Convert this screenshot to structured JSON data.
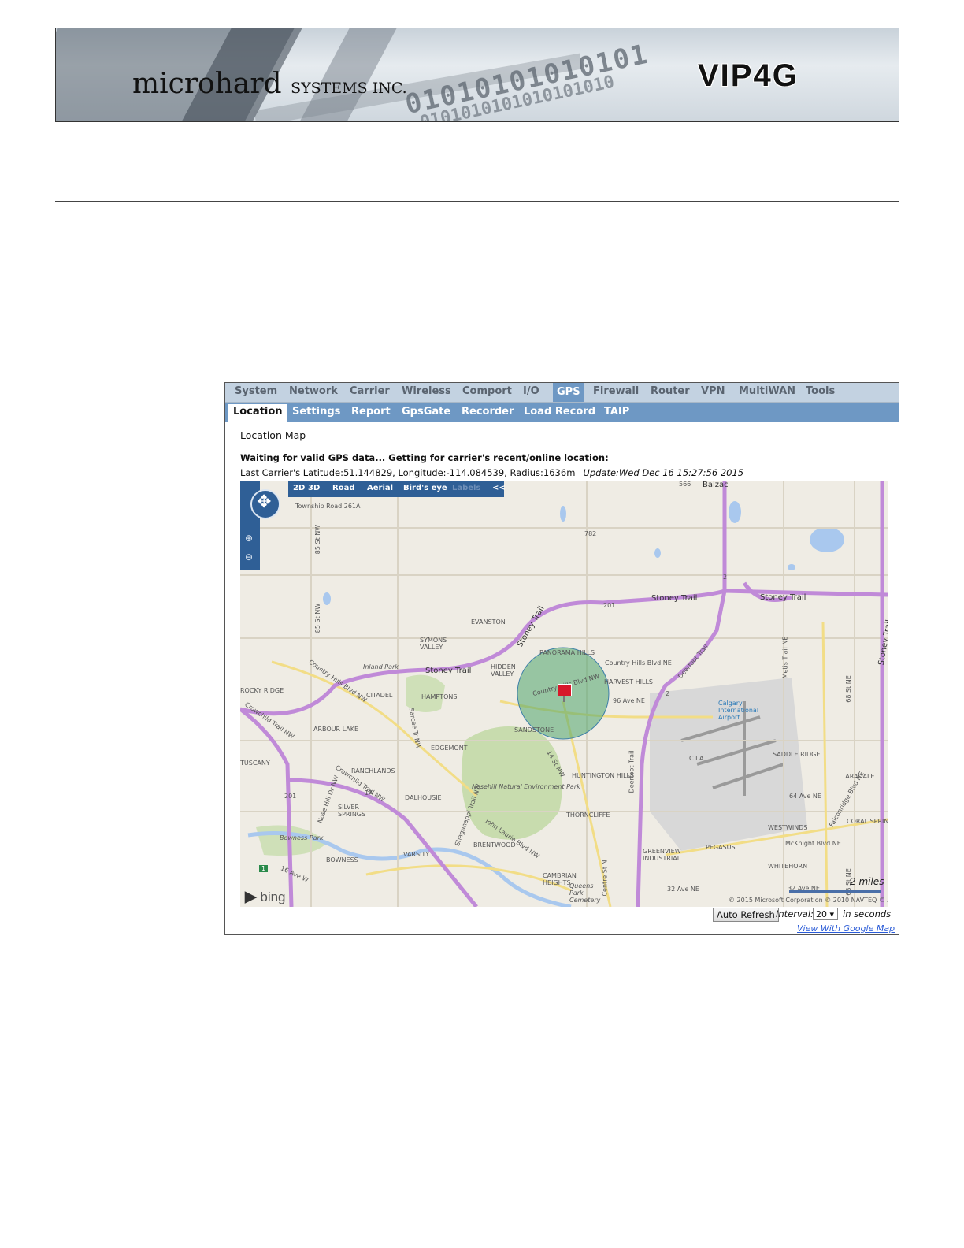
{
  "header": {
    "brand_main": "microhard",
    "brand_suffix": "SYSTEMS INC.",
    "product": "VIP4G",
    "binary_top": "01010101010101",
    "binary_bottom": "0101010101010101010"
  },
  "menu": {
    "items": [
      "System",
      "Network",
      "Carrier",
      "Wireless",
      "Comport",
      "I/O",
      "GPS",
      "Firewall",
      "Router",
      "VPN",
      "MultiWAN",
      "Tools"
    ],
    "active": "GPS"
  },
  "submenu": {
    "items": [
      "Location",
      "Settings",
      "Report",
      "GpsGate",
      "Recorder",
      "Load Record",
      "TAIP"
    ],
    "active": "Location"
  },
  "content": {
    "title": "Location Map",
    "waiting": "Waiting for valid GPS data... Getting for carrier's recent/online location:",
    "coords": "Last Carrier's Latitude:51.144829, Longitude:-114.084539, Radius:1636m",
    "update": "Update:Wed Dec 16 15:27:56 2015"
  },
  "map": {
    "nav": {
      "d2": "2D",
      "d3": "3D",
      "road": "Road",
      "aerial": "Aerial",
      "birds_eye": "Bird's eye",
      "labels": "Labels",
      "collapse": "<<"
    },
    "provider": "bing",
    "scale_label": "2 miles",
    "copyright": "© 2015 Microsoft Corporation   © 2010 NAVTEQ   © AND",
    "labels": {
      "balzac": "Balzac",
      "township": "Township Road 261A",
      "stoney1": "Stoney Trail",
      "stoney2": "Stoney Trail",
      "stoney3": "Stoney Trail",
      "stoney4": "Stoney Trail",
      "stoney_right": "Stoney Trail",
      "country_hills": "Country Hills Blvd NE",
      "country_hills2": "Country Hills Blvd NW",
      "country_hills_center": "Country Hills Blvd NW",
      "deerfoot": "Deerfoot Trail",
      "deerfoot2": "Deerfoot Trail",
      "ave96": "96 Ave NE",
      "ave64": "64 Ave NE",
      "ave32": "32 Ave NE",
      "ave32b": "32 Ave NE",
      "mcknight": "McKnight Blvd NE",
      "crowchild": "Crowchild Trail NW",
      "ave16": "16 Ave W",
      "sarcee": "Sarcee Tr NW",
      "st85a": "85 St NW",
      "st85b": "85 St NW",
      "st14": "14 St NW",
      "shaganappi": "Shaganappi Trail NW",
      "john_laurie": "John Laurie Blvd NW",
      "centre": "Centre St N",
      "metis": "Metis Trail NE",
      "st68": "68 St NE",
      "st68b": "68 St NE",
      "nose_hill": "Nosehill Natural Environment Park",
      "airport": "Calgary International Airport",
      "queens": "Queens Park Cemetery",
      "inland": "Inland Park",
      "bowness_park": "Bowness Park",
      "evanston": "EVANSTON",
      "symons": "SYMONS VALLEY",
      "panorama": "PANORAMA HILLS",
      "hidden": "HIDDEN VALLEY",
      "harvest": "HARVEST HILLS",
      "kincora": "KINCORA",
      "hamptons": "HAMPTONS",
      "citadel": "CITADEL",
      "rocky": "ROCKY RIDGE",
      "arbour": "ARBOUR LAKE",
      "tuscany": "TUSCANY",
      "ranchlands": "RANCHLANDS",
      "edgemont": "EDGEMONT",
      "sandstone": "SANDSTONE",
      "huntington": "HUNTINGTON HILLS",
      "thorncliffe": "THORNCLIFFE",
      "dalhousie": "DALHOUSIE",
      "silver": "SILVER SPRINGS",
      "varsity": "VARSITY",
      "brentwood": "BRENTWOOD",
      "bowness": "BOWNESS",
      "cambrian": "CAMBRIAN HEIGHTS",
      "greenview": "GREENVIEW INDUSTRIAL",
      "pegasus": "PEGASUS",
      "saddle": "SADDLE RIDGE",
      "taradale": "TARADALE",
      "coral": "CORAL SPRINGS",
      "westwinds": "WESTWINDS",
      "whitehorn": "WHITEHORN",
      "cia": "C.I.A.",
      "falconridge": "Falconridge Blvd NE",
      "nosehill_dr": "Nose Hill Dr NW",
      "crowchild2": "Crowchild Trail NW",
      "hwy566": "566",
      "hwy782": "782",
      "hwy2a": "2",
      "hwy201a": "201",
      "hwy2b": "2",
      "hwy201b": "201",
      "hwy1a": "1A",
      "hwy1": "1"
    }
  },
  "controls": {
    "refresh": "Auto Refresh",
    "interval_label": "Interval:",
    "interval_value": "20 ▾",
    "interval_unit": "in seconds",
    "google_link": "View With Google Map"
  },
  "colors": {
    "menu_bg": "#c3d2e1",
    "submenu_bg": "#6e98c4",
    "freeway": "#c08ad8",
    "radius_fill": "#4fa66b",
    "pin": "#d7182a",
    "link": "#2a5bd7"
  }
}
